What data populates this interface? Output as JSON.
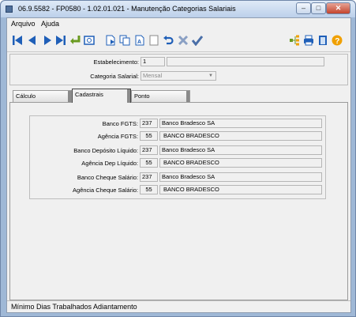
{
  "window": {
    "title": "06.9.5582 - FP0580 - 1.02.01.021 - Manutenção Categorias Salariais",
    "min_glyph": "–",
    "max_glyph": "□",
    "close_glyph": "✕"
  },
  "menu": {
    "items": [
      {
        "label": "Arquivo"
      },
      {
        "label": "Ajuda"
      }
    ]
  },
  "toolbar": {
    "icons": [
      "first-record-icon",
      "previous-record-icon",
      "next-record-icon",
      "last-record-icon",
      "goto-record-icon",
      "zoom-icon",
      "new-record-icon",
      "copy-record-icon",
      "edit-record-icon",
      "delete-record-icon",
      "undo-icon",
      "cancel-icon",
      "confirm-icon",
      "tree-icon",
      "print-icon",
      "exit-icon",
      "help-icon"
    ]
  },
  "header": {
    "estabelecimento_label": "Estabelecimento:",
    "estabelecimento_value": "1",
    "estabelecimento_desc": "",
    "categoria_label": "Categoria Salarial:",
    "categoria_value": "Mensal"
  },
  "tabs": [
    {
      "label": "Cálculo"
    },
    {
      "label": "Cadastrais"
    },
    {
      "label": "Ponto"
    }
  ],
  "active_tab": "Cadastrais",
  "bank_fields": [
    {
      "label": "Banco FGTS:",
      "code": "237",
      "desc": "Banco Bradesco SA"
    },
    {
      "label": "Agência FGTS:",
      "code": "55",
      "desc": "BANCO BRADESCO"
    },
    {
      "label": "Banco Depósito Líquido:",
      "code": "237",
      "desc": "Banco Bradesco SA"
    },
    {
      "label": "Agência Dep Líquido:",
      "code": "55",
      "desc": "BANCO BRADESCO"
    },
    {
      "label": "Banco Cheque Salário:",
      "code": "237",
      "desc": "Banco Bradesco SA"
    },
    {
      "label": "Agência Cheque Salário:",
      "code": "55",
      "desc": "BANCO BRADESCO"
    }
  ],
  "status": {
    "text": "Mínimo Dias Trabalhados Adiantamento"
  },
  "colors": {
    "toolbar_blue": "#1f5fb8",
    "accent_orange": "#f0a000",
    "title_bar": "#bcd0ea",
    "close_red": "#c4442d"
  }
}
